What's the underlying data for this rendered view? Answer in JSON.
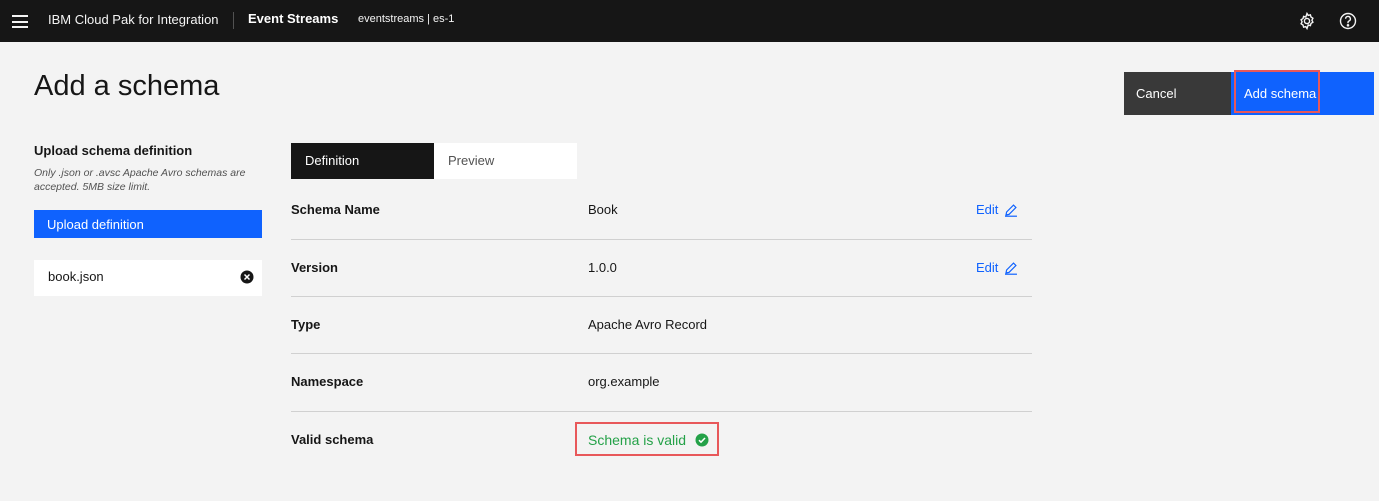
{
  "header": {
    "brand": "IBM Cloud Pak for Integration",
    "product": "Event Streams",
    "instance": "eventstreams | es-1",
    "icons": [
      "menu-icon",
      "settings-icon",
      "help-icon"
    ]
  },
  "page": {
    "title": "Add a schema",
    "cancel_label": "Cancel",
    "add_label": "Add schema"
  },
  "upload": {
    "title": "Upload schema definition",
    "help": "Only .json or .avsc Apache Avro schemas are accepted. 5MB size limit.",
    "button_label": "Upload definition",
    "file_name": "book.json"
  },
  "tabs": [
    {
      "label": "Definition",
      "selected": true
    },
    {
      "label": "Preview",
      "selected": false
    }
  ],
  "schema": {
    "rows": [
      {
        "label": "Schema Name",
        "value": "Book",
        "edit": "Edit"
      },
      {
        "label": "Version",
        "value": "1.0.0",
        "edit": "Edit"
      },
      {
        "label": "Type",
        "value": "Apache Avro Record"
      },
      {
        "label": "Namespace",
        "value": "org.example"
      },
      {
        "label": "Valid schema",
        "value": "Schema is valid"
      }
    ]
  },
  "colors": {
    "accent": "#0f62fe",
    "success": "#24a148",
    "highlight": "#e8585a",
    "header_bg": "#161616"
  }
}
